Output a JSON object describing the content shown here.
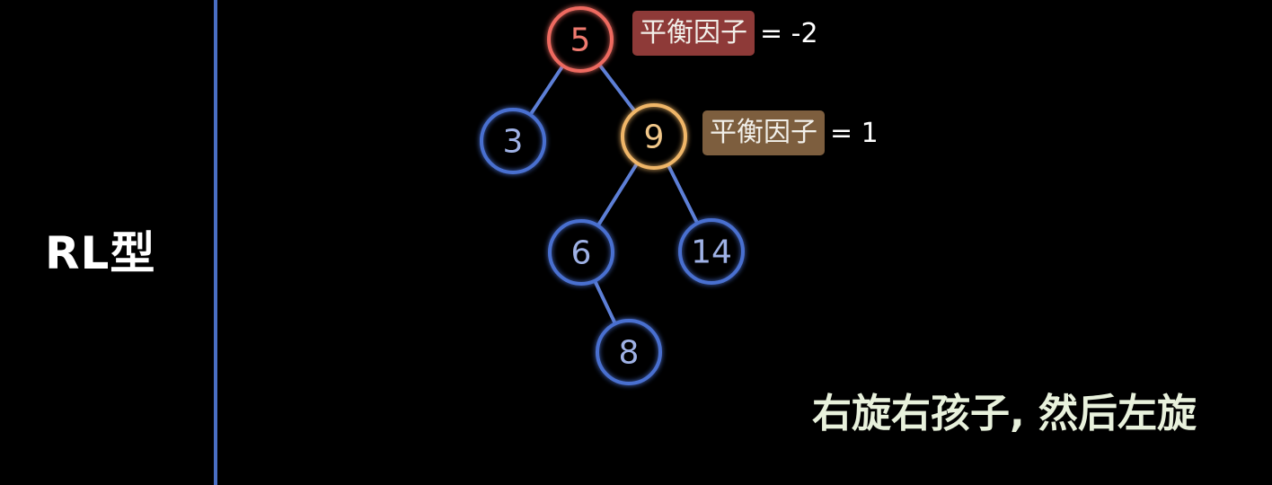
{
  "type_label": "RL型",
  "caption": "右旋右孩子, 然后左旋",
  "balance_factors": {
    "root": {
      "tag": "平衡因子",
      "eq": "= -2"
    },
    "right_child": {
      "tag": "平衡因子",
      "eq": "= 1"
    }
  },
  "colors": {
    "normal": "#4a6fd0",
    "normal_glow": "#2f4fa8",
    "normal_text": "#9fb2e6",
    "unbalanced": "#ee6a60",
    "unbalanced_text": "#ef7a6f",
    "pivot": "#f0b667",
    "pivot_text": "#f2c88a",
    "edge": "#5d7fd6",
    "divider": "#4a6fc4"
  },
  "tree": {
    "nodes": [
      {
        "id": "n5",
        "label": "5",
        "state": "unbalanced"
      },
      {
        "id": "n3",
        "label": "3",
        "state": "normal"
      },
      {
        "id": "n9",
        "label": "9",
        "state": "pivot"
      },
      {
        "id": "n6",
        "label": "6",
        "state": "normal"
      },
      {
        "id": "n14",
        "label": "14",
        "state": "normal"
      },
      {
        "id": "n8",
        "label": "8",
        "state": "normal"
      }
    ],
    "edges": [
      [
        "n5",
        "n3"
      ],
      [
        "n5",
        "n9"
      ],
      [
        "n9",
        "n6"
      ],
      [
        "n9",
        "n14"
      ],
      [
        "n6",
        "n8"
      ]
    ]
  }
}
